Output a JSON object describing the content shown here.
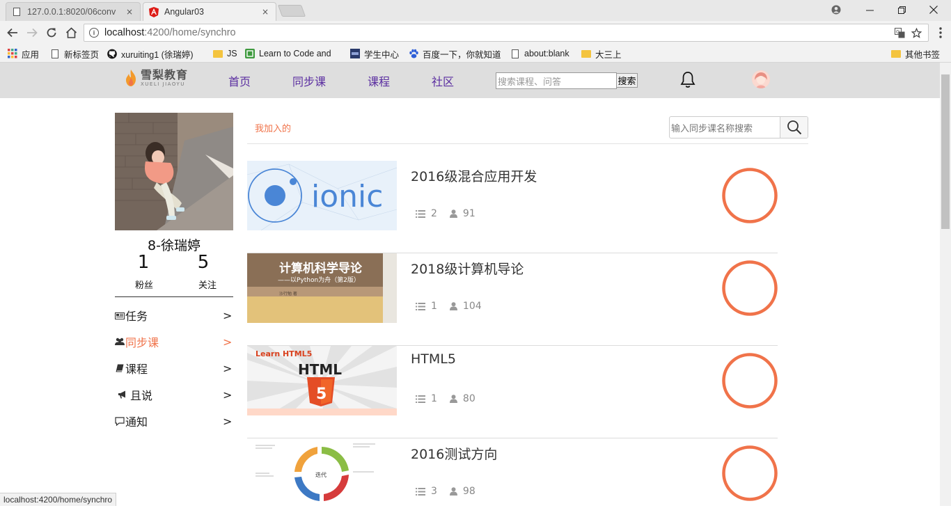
{
  "browser": {
    "tabs": [
      {
        "title": "127.0.0.1:8020/06conv",
        "close": "×",
        "active": false
      },
      {
        "title": "Angular03",
        "close": "×",
        "active": true
      }
    ],
    "address": {
      "host": "localhost",
      "path": ":4200/home/synchro"
    },
    "bookmarks": [
      "应用",
      "新标签页",
      "xuruiting1 (徐瑞婷)",
      "JS",
      "Learn to Code and",
      "学生中心",
      "百度一下，你就知道",
      "about:blank",
      "大三上"
    ],
    "other_bookmarks": "其他书签",
    "status_url": "localhost:4200/home/synchro"
  },
  "site": {
    "logo_main": "雪梨教育",
    "logo_sub": "XUELI JIAOYU",
    "nav": [
      "首页",
      "同步课",
      "课程",
      "社区"
    ],
    "search_placeholder": "搜索课程、问答",
    "search_button": "搜索",
    "colors": {
      "accent": "#f0734a",
      "nav": "#5a2da0",
      "header_bg": "#dedede"
    }
  },
  "profile": {
    "name": "8-徐瑞婷",
    "fans_count": "1",
    "fans_label": "粉丝",
    "follow_count": "5",
    "follow_label": "关注"
  },
  "sidebar": {
    "items": [
      {
        "label": "任务",
        "arrow": ">",
        "icon": "newspaper-icon"
      },
      {
        "label": "同步课",
        "arrow": ">",
        "icon": "users-icon",
        "active": true
      },
      {
        "label": "课程",
        "arrow": ">",
        "icon": "book-icon"
      },
      {
        "label": "且说",
        "arrow": ">",
        "icon": "bullhorn-icon"
      },
      {
        "label": "通知",
        "arrow": ">",
        "icon": "comment-icon"
      }
    ]
  },
  "content": {
    "section_tab": "我加入的",
    "course_search_placeholder": "输入同步课名称搜索",
    "courses": [
      {
        "title": "2016级混合应用开发",
        "lessons": "2",
        "members": "91",
        "thumb": "ionic",
        "thumb_text": "ionic"
      },
      {
        "title": "2018级计算机导论",
        "lessons": "1",
        "members": "104",
        "thumb": "book",
        "thumb_text": "计算机科学导论",
        "thumb_sub": "——以Python为舟（第2版）",
        "thumb_author": "沙行勉 著"
      },
      {
        "title": "HTML5",
        "lessons": "1",
        "members": "80",
        "thumb": "html5",
        "thumb_text": "Learn HTML5",
        "thumb_sub": "HTML",
        "thumb_num": "5"
      },
      {
        "title": "2016测试方向",
        "lessons": "3",
        "members": "98",
        "thumb": "cycle",
        "thumb_text": "迭代"
      }
    ]
  }
}
